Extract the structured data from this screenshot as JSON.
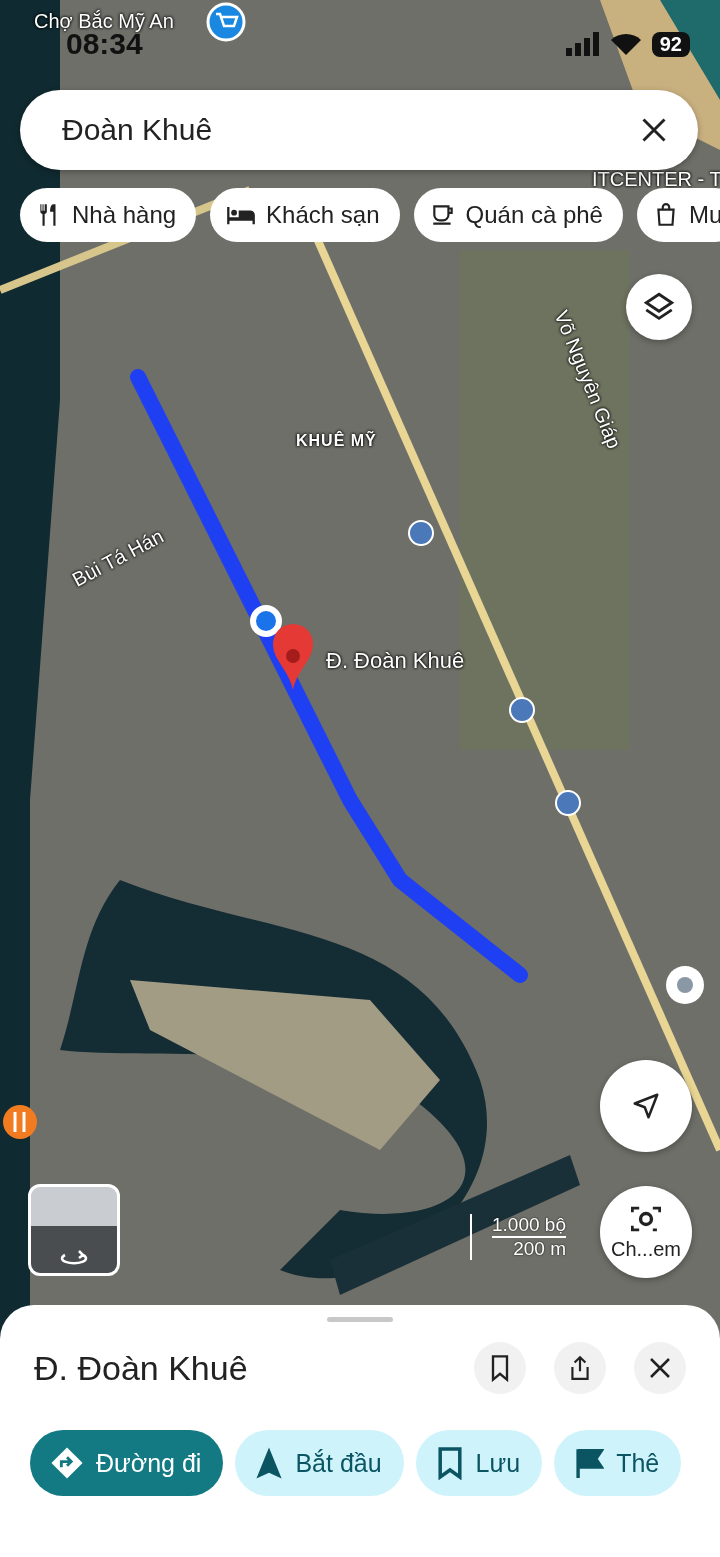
{
  "status_bar": {
    "time": "08:34",
    "battery": "92"
  },
  "search": {
    "value": "Đoàn Khuê"
  },
  "chips": [
    {
      "kind": "restaurant",
      "label": "Nhà hàng"
    },
    {
      "kind": "hotel",
      "label": "Khách sạn"
    },
    {
      "kind": "cafe",
      "label": "Quán cà phê"
    },
    {
      "kind": "shopping",
      "label": "Mu"
    }
  ],
  "map": {
    "labels": [
      {
        "text": "Chợ Bắc Mỹ An",
        "kind": "poi"
      },
      {
        "text": "KHUÊ MỸ",
        "kind": "area"
      },
      {
        "text": "Bùi Tá Hán",
        "kind": "street"
      },
      {
        "text": "Võ Nguyên Giáp",
        "kind": "street"
      },
      {
        "text": "ITCENTER - T",
        "kind": "poi"
      }
    ],
    "pin_label": "Đ. Đoàn Khuê",
    "scale": {
      "imperial": "1.000 bộ",
      "metric": "200 m"
    },
    "lens_label": "Ch...em"
  },
  "place": {
    "title": "Đ. Đoàn Khuê",
    "actions": [
      {
        "kind": "directions",
        "label": "Đường đi",
        "primary": true
      },
      {
        "kind": "start",
        "label": "Bắt đầu",
        "primary": false
      },
      {
        "kind": "save",
        "label": "Lưu",
        "primary": false
      },
      {
        "kind": "label",
        "label": "Thê",
        "primary": false
      }
    ]
  }
}
